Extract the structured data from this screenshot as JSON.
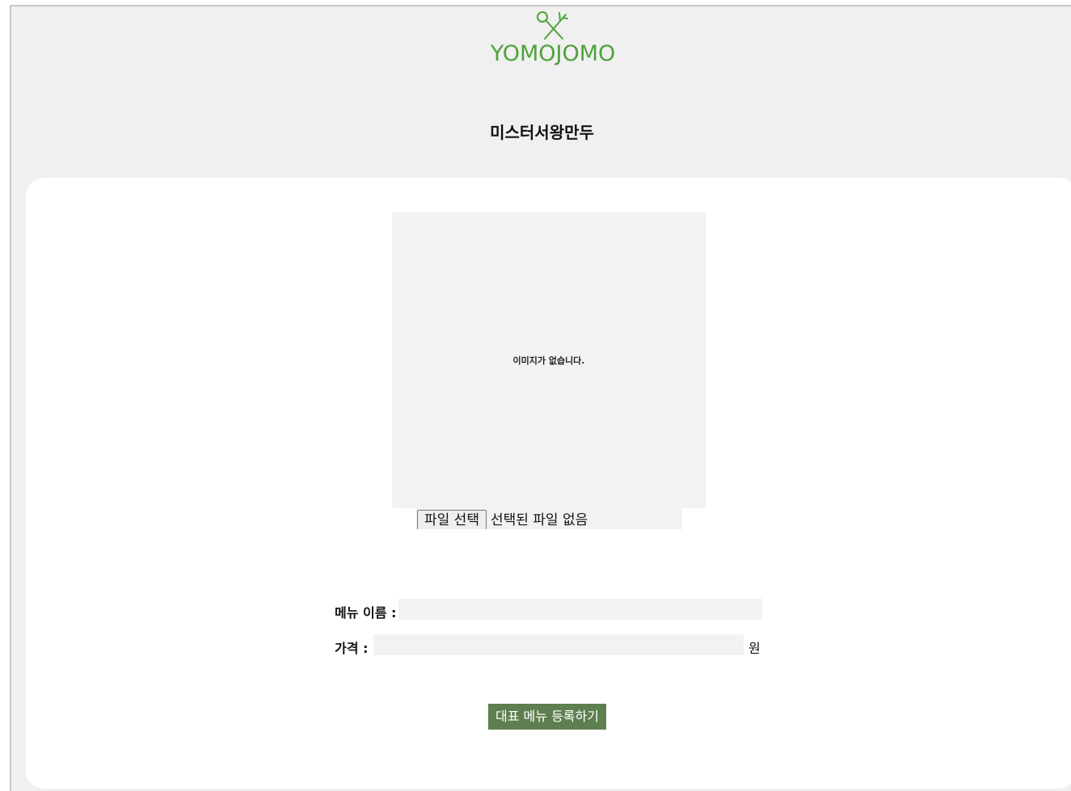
{
  "header": {
    "logo_text": "YOMOJOMO",
    "brand_color": "#4fa23b",
    "logo_icon": "crossed-utensils-icon"
  },
  "store": {
    "name": "미스터서왕만두"
  },
  "image_upload": {
    "empty_message": "이미지가 없습니다.",
    "file_button_label": "파일 선택",
    "file_status": "선택된 파일 없음"
  },
  "form": {
    "menu_name_label": "메뉴 이름 :",
    "menu_name_value": "",
    "price_label": "가격 :",
    "price_value": "",
    "price_unit": "원",
    "submit_label": "대표 메뉴 등록하기",
    "submit_color": "#5e7f50"
  }
}
